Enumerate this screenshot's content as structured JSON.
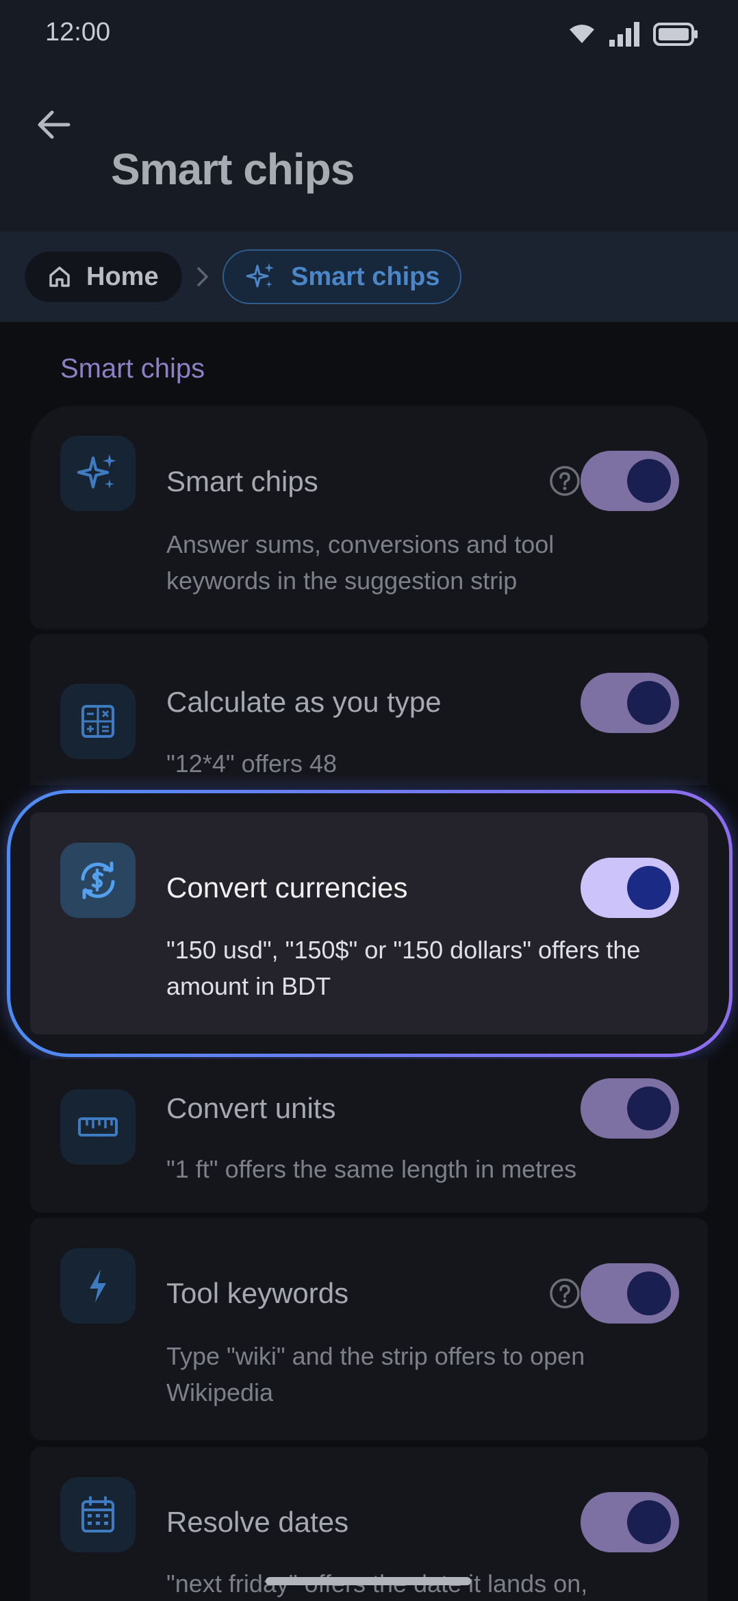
{
  "status_bar": {
    "time": "12:00"
  },
  "header": {
    "title": "Smart chips",
    "back_icon": "arrow-left-icon"
  },
  "breadcrumb": {
    "home_label": "Home",
    "current_label": "Smart chips"
  },
  "section": {
    "title": "Smart chips"
  },
  "settings": [
    {
      "icon": "sparkles-icon",
      "title": "Smart chips",
      "description": "Answer sums, conversions and tool keywords in the suggestion strip",
      "enabled": true,
      "has_help": true
    },
    {
      "icon": "calculator-icon",
      "title": "Calculate as you type",
      "description": "\"12*4\" offers 48",
      "enabled": true,
      "has_help": false
    },
    {
      "icon": "currency-exchange-icon",
      "title": "Convert currencies",
      "description": "\"150 usd\", \"150$\" or \"150 dollars\" offers the amount in BDT",
      "enabled": true,
      "has_help": false
    },
    {
      "icon": "ruler-icon",
      "title": "Convert units",
      "description": "\"1 ft\" offers the same length in metres",
      "enabled": true,
      "has_help": false
    },
    {
      "icon": "bolt-icon",
      "title": "Tool keywords",
      "description": "Type \"wiki\" and the strip offers to open Wikipedia",
      "enabled": true,
      "has_help": true
    },
    {
      "icon": "calendar-icon",
      "title": "Resolve dates",
      "description": "\"next friday\" offers the date it lands on,",
      "enabled": true,
      "has_help": false
    }
  ],
  "colors": {
    "accent_toggle": "#7d71a3",
    "accent_toggle_focused": "#cdc3fb",
    "highlight_gradient_start": "#4d8cf5",
    "highlight_gradient_end": "#8f6cf1"
  }
}
